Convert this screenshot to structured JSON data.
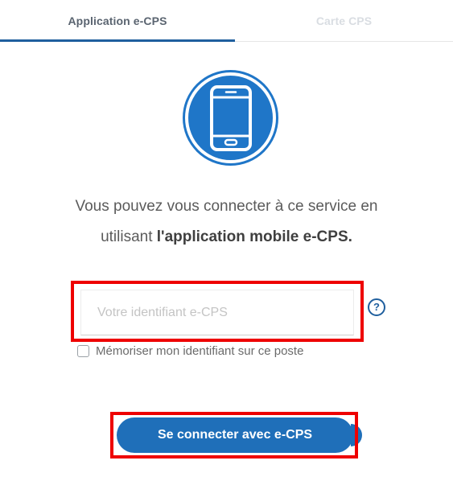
{
  "tabs": {
    "app_label": "Application e-CPS",
    "card_label": "Carte CPS"
  },
  "icon": {
    "name": "smartphone-icon",
    "color": "#1f76c8"
  },
  "intro": {
    "line1": "Vous pouvez vous connecter à ce service en",
    "line2_prefix": "utilisant ",
    "line2_bold": "l'application mobile e-CPS."
  },
  "identifier": {
    "placeholder": "Votre identifiant e-CPS",
    "value": ""
  },
  "help": {
    "label": "?"
  },
  "remember": {
    "label": "Mémoriser mon identifiant sur ce poste"
  },
  "connect_button": {
    "label": "Se connecter avec e-CPS"
  },
  "colors": {
    "primary": "#1f6fb9",
    "highlight": "#ee0000",
    "tab_active": "#1f5f9e"
  }
}
